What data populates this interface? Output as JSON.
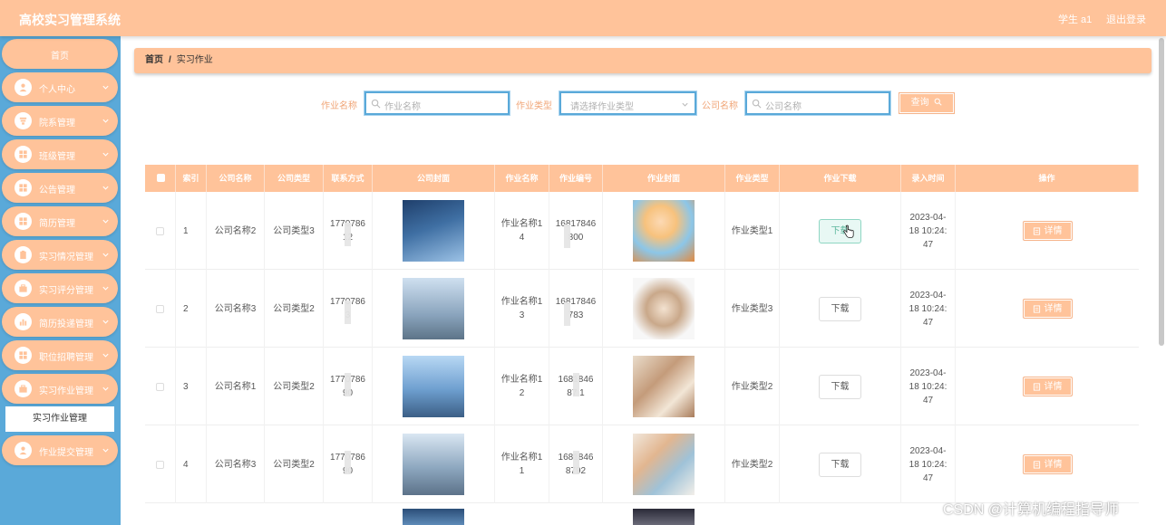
{
  "header": {
    "title": "高校实习管理系统",
    "user": "学生 a1",
    "logout": "退出登录"
  },
  "sidebar": {
    "home": "首页",
    "items": [
      {
        "label": "个人中心",
        "icon": "user-icon"
      },
      {
        "label": "院系管理",
        "icon": "filter-icon"
      },
      {
        "label": "班级管理",
        "icon": "grid-icon"
      },
      {
        "label": "公告管理",
        "icon": "grid-icon"
      },
      {
        "label": "简历管理",
        "icon": "grid-icon"
      },
      {
        "label": "实习情况管理",
        "icon": "clipboard-icon"
      },
      {
        "label": "实习评分管理",
        "icon": "briefcase-icon"
      },
      {
        "label": "简历投递管理",
        "icon": "bar-chart-icon"
      },
      {
        "label": "职位招聘管理",
        "icon": "grid-icon"
      },
      {
        "label": "实习作业管理",
        "icon": "briefcase-icon"
      },
      {
        "label": "作业提交管理",
        "icon": "user-icon"
      }
    ],
    "sub_item": "实习作业管理"
  },
  "breadcrumb": {
    "home": "首页",
    "sep": "/",
    "current": "实习作业"
  },
  "search": {
    "name_label": "作业名称",
    "name_placeholder": "作业名称",
    "type_label": "作业类型",
    "type_placeholder": "请选择作业类型",
    "company_label": "公司名称",
    "company_placeholder": "公司名称",
    "query": "查询"
  },
  "table": {
    "headers": [
      "索引",
      "公司名称",
      "公司类型",
      "联系方式",
      "公司封面",
      "作业名称",
      "作业编号",
      "作业封面",
      "作业类型",
      "作业下载",
      "录入时间",
      "操作"
    ],
    "download_label": "下载",
    "detail_label": "详情",
    "rows": [
      {
        "index": "1",
        "company": "公司名称2",
        "ctype": "公司类型3",
        "contact": "1770786\n 12",
        "work_name": "作业名称1\n4",
        "work_no": "16817846\n 800",
        "work_type": "作业类型1",
        "time": "2023-04-\n18 10:24:\n47"
      },
      {
        "index": "2",
        "company": "公司名称3",
        "ctype": "公司类型2",
        "contact": "1770786\n 3",
        "work_name": "作业名称1\n3",
        "work_no": "16817846\n 783",
        "work_type": "作业类型3",
        "time": "2023-04-\n18 10:24:\n47"
      },
      {
        "index": "3",
        "company": "公司名称1",
        "ctype": "公司类型2",
        "contact": "1770786\n90",
        "work_name": "作业名称1\n2",
        "work_no": "1681846\n87 1",
        "work_type": "作业类型2",
        "time": "2023-04-\n18 10:24:\n47"
      },
      {
        "index": "4",
        "company": "公司名称3",
        "ctype": "公司类型2",
        "contact": "1770786\n90",
        "work_name": "作业名称1\n1",
        "work_no": "1681846\n8792",
        "work_type": "作业类型2",
        "time": "2023-04-\n18 10:24:\n47"
      }
    ]
  },
  "watermark": "CSDN @计算机编程指导师"
}
